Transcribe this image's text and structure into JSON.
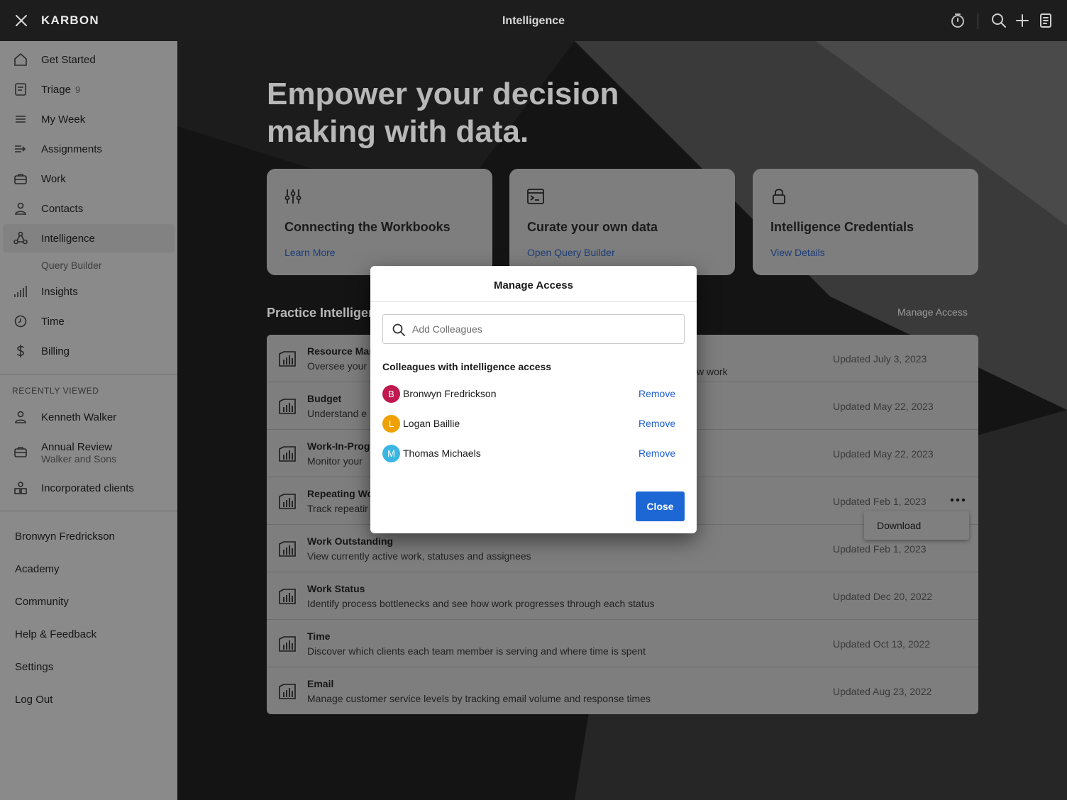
{
  "app": {
    "brand": "KARBON",
    "title": "Intelligence"
  },
  "sidebar": {
    "nav": [
      {
        "label": "Get Started",
        "icon": "home-icon"
      },
      {
        "label": "Triage",
        "count": "9",
        "icon": "triage-icon"
      },
      {
        "label": "My Week",
        "icon": "list-icon"
      },
      {
        "label": "Assignments",
        "icon": "assignments-icon"
      },
      {
        "label": "Work",
        "icon": "briefcase-icon"
      },
      {
        "label": "Contacts",
        "icon": "person-icon"
      },
      {
        "label": "Intelligence",
        "icon": "network-icon",
        "active": true
      },
      {
        "label": "Insights",
        "icon": "bar-chart-icon"
      },
      {
        "label": "Time",
        "icon": "clock-icon"
      },
      {
        "label": "Billing",
        "icon": "dollar-icon"
      }
    ],
    "sub_item": "Query Builder",
    "recent_label": "RECENTLY VIEWED",
    "recent": [
      {
        "label": "Kenneth Walker",
        "icon": "person-icon"
      },
      {
        "label": "Annual Review",
        "sub": "Walker and Sons",
        "icon": "briefcase-icon"
      },
      {
        "label": "Incorporated clients",
        "icon": "shapes-icon"
      }
    ],
    "bottom": [
      "Bronwyn Fredrickson",
      "Academy",
      "Community",
      "Help & Feedback",
      "Settings",
      "Log Out"
    ]
  },
  "hero": {
    "line1": "Empower your decision",
    "line2": "making with data."
  },
  "cards": [
    {
      "title": "Connecting the Workbooks",
      "link": "Learn More",
      "icon": "sliders-icon"
    },
    {
      "title": "Curate your own data",
      "link": "Open Query Builder",
      "icon": "terminal-icon"
    },
    {
      "title": "Intelligence Credentials",
      "link": "View Details",
      "icon": "lock-icon"
    }
  ],
  "section": {
    "title": "Practice Intelligen",
    "manage": "Manage Access"
  },
  "workbooks": [
    {
      "name": "Resource Mar",
      "desc": "Oversee your",
      "date": "Updated July 3, 2023",
      "peek": "w work"
    },
    {
      "name": "Budget",
      "desc": "Understand e",
      "date": "Updated May 22, 2023"
    },
    {
      "name": "Work-In-Prog",
      "desc": "Monitor your",
      "date": "Updated May 22, 2023"
    },
    {
      "name": "Repeating Wo",
      "desc": "Track repeatir",
      "date": "Updated Feb 1, 2023"
    },
    {
      "name": "Work Outstanding",
      "desc": "View currently active work, statuses and assignees",
      "date": "Updated Feb 1, 2023"
    },
    {
      "name": "Work Status",
      "desc": "Identify process bottlenecks and see how work progresses through each status",
      "date": "Updated Dec 20, 2022"
    },
    {
      "name": "Time",
      "desc": "Discover which clients each team member is serving and where time is spent",
      "date": "Updated Oct 13, 2022"
    },
    {
      "name": "Email",
      "desc": "Manage customer service levels by tracking email volume and response times",
      "date": "Updated Aug 23, 2022"
    }
  ],
  "dropdown": {
    "item": "Download"
  },
  "modal": {
    "title": "Manage Access",
    "search_placeholder": "Add Colleagues",
    "subheading": "Colleagues with intelligence access",
    "people": [
      {
        "initial": "B",
        "name": "Bronwyn Fredrickson",
        "color": "#c0184f",
        "action": "Remove"
      },
      {
        "initial": "L",
        "name": "Logan Baillie",
        "color": "#eea100",
        "action": "Remove"
      },
      {
        "initial": "M",
        "name": "Thomas Michaels",
        "color": "#3bb6e3",
        "action": "Remove"
      }
    ],
    "close_label": "Close"
  },
  "colors": {
    "accent": "#1d67d4",
    "link": "#1f5fcf",
    "topbar": "#1d1d1d"
  }
}
